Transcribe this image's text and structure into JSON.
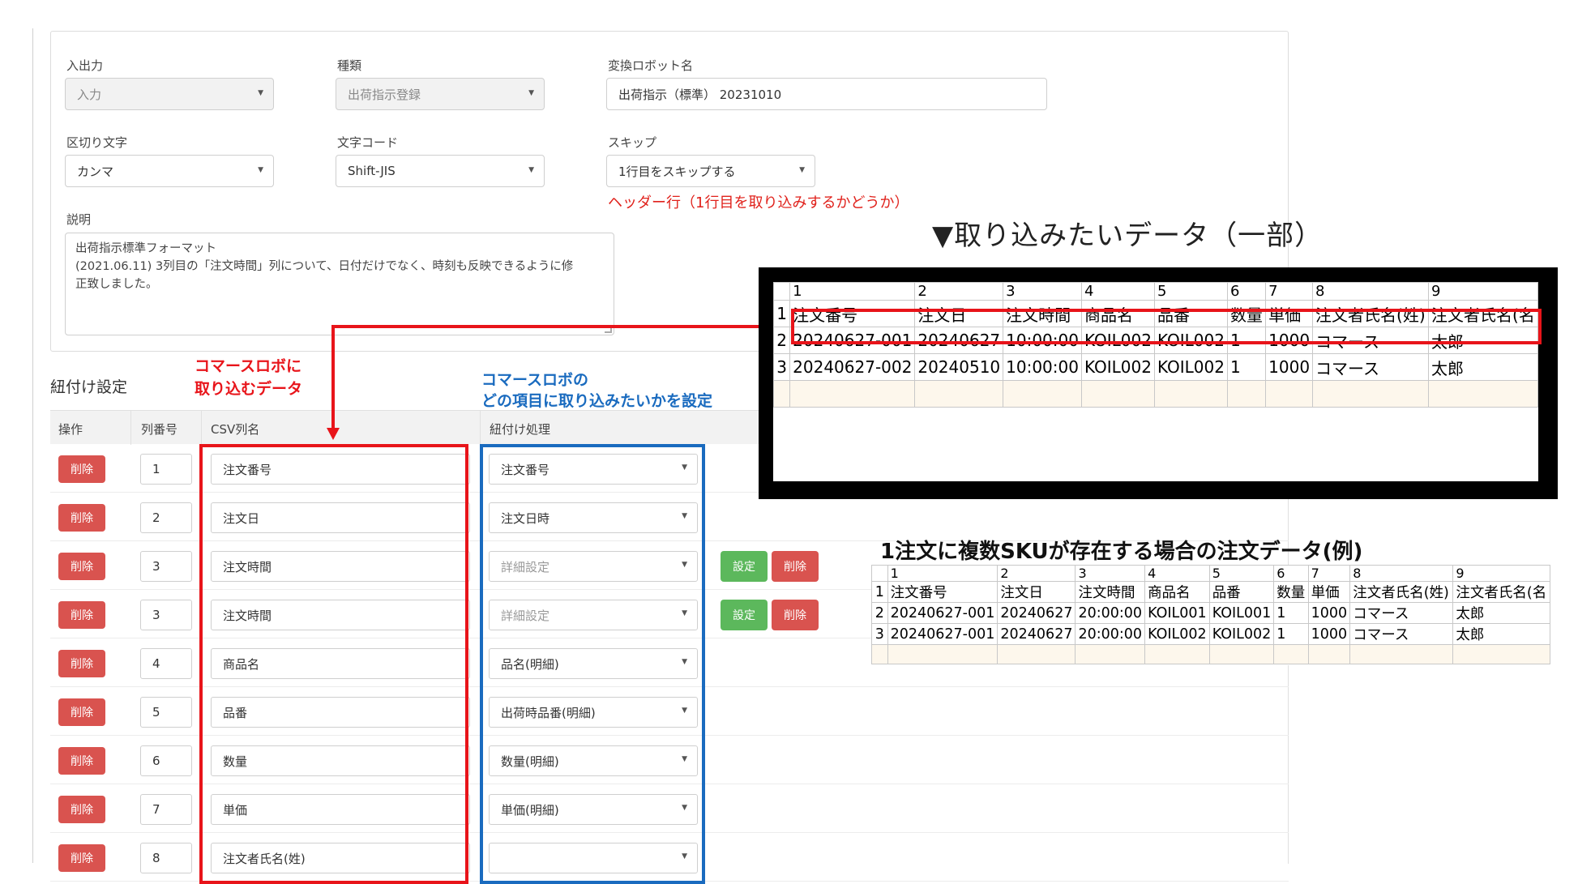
{
  "form": {
    "io": {
      "label": "入出力",
      "value": "入力"
    },
    "type": {
      "label": "種類",
      "value": "出荷指示登録"
    },
    "robot_name": {
      "label": "変換ロボット名",
      "value": "出荷指示（標準） 20231010"
    },
    "delimiter": {
      "label": "区切り文字",
      "value": "カンマ"
    },
    "encoding": {
      "label": "文字コード",
      "value": "Shift-JIS"
    },
    "skip": {
      "label": "スキップ",
      "value": "1行目をスキップする"
    },
    "description": {
      "label": "説明",
      "value": "出荷指示標準フォーマット\n(2021.06.11) 3列目の「注文時間」列について、日付だけでなく、時刻も反映できるように修\n正致しました。"
    }
  },
  "annotations": {
    "skip_note": "ヘッダー行（1行目を取り込みするかどうか）",
    "import_title": "▼取り込みたいデータ（一部）",
    "red_label_1": "コマースロボに",
    "red_label_2": "取り込むデータ",
    "blue_label_1": "コマースロボの",
    "blue_label_2": "どの項目に取り込みたいかを設定",
    "multi_sku_title": "1注文に複数SKUが存在する場合の注文データ(例)"
  },
  "mapping": {
    "title": "紐付け設定",
    "headers": {
      "action": "操作",
      "col_no": "列番号",
      "csv_name": "CSV列名",
      "mapping": "紐付け処理"
    },
    "delete_label": "削除",
    "settings_label": "設定",
    "rows": [
      {
        "num": "1",
        "csv": "注文番号",
        "map": "注文番号",
        "muted": false,
        "extra": false
      },
      {
        "num": "2",
        "csv": "注文日",
        "map": "注文日時",
        "muted": false,
        "extra": false
      },
      {
        "num": "3",
        "csv": "注文時間",
        "map": "詳細設定",
        "muted": true,
        "extra": true
      },
      {
        "num": "3",
        "csv": "注文時間",
        "map": "詳細設定",
        "muted": true,
        "extra": true
      },
      {
        "num": "4",
        "csv": "商品名",
        "map": "品名(明細)",
        "muted": false,
        "extra": false
      },
      {
        "num": "5",
        "csv": "品番",
        "map": "出荷時品番(明細)",
        "muted": false,
        "extra": false
      },
      {
        "num": "6",
        "csv": "数量",
        "map": "数量(明細)",
        "muted": false,
        "extra": false
      },
      {
        "num": "7",
        "csv": "単価",
        "map": "単価(明細)",
        "muted": false,
        "extra": false
      },
      {
        "num": "8",
        "csv": "注文者氏名(姓)",
        "map": "",
        "muted": false,
        "extra": false
      }
    ]
  },
  "sheet1": {
    "col_numbers": [
      "1",
      "2",
      "3",
      "4",
      "5",
      "6",
      "7",
      "8",
      "9"
    ],
    "rows": [
      {
        "rn": "1",
        "cells": [
          "注文番号",
          "注文日",
          "注文時間",
          "商品名",
          "品番",
          "数量",
          "単価",
          "注文者氏名(姓)",
          "注文者氏名(名"
        ]
      },
      {
        "rn": "2",
        "cells": [
          "20240627-001",
          "20240627",
          "10:00:00",
          "KOIL002",
          "KOIL002",
          "1",
          "1000",
          "コマース",
          "太郎"
        ]
      },
      {
        "rn": "3",
        "cells": [
          "20240627-002",
          "20240510",
          "10:00:00",
          "KOIL002",
          "KOIL002",
          "1",
          "1000",
          "コマース",
          "太郎"
        ]
      }
    ]
  },
  "sheet2": {
    "col_numbers": [
      "1",
      "2",
      "3",
      "4",
      "5",
      "6",
      "7",
      "8",
      "9"
    ],
    "rows": [
      {
        "rn": "1",
        "cells": [
          "注文番号",
          "注文日",
          "注文時間",
          "商品名",
          "品番",
          "数量",
          "単価",
          "注文者氏名(姓)",
          "注文者氏名(名"
        ]
      },
      {
        "rn": "2",
        "cells": [
          "20240627-001",
          "20240627",
          "20:00:00",
          "KOIL001",
          "KOIL001",
          "1",
          "1000",
          "コマース",
          "太郎"
        ]
      },
      {
        "rn": "3",
        "cells": [
          "20240627-001",
          "20240627",
          "20:00:00",
          "KOIL002",
          "KOIL002",
          "1",
          "1000",
          "コマース",
          "太郎"
        ]
      }
    ]
  }
}
